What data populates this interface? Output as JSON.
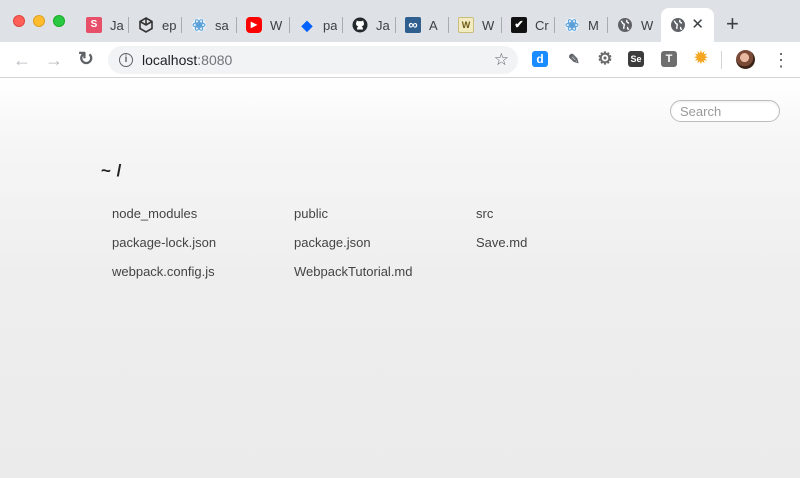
{
  "window": {
    "controls": [
      "close",
      "minimize",
      "zoom"
    ]
  },
  "tabs": [
    {
      "title": "Ja",
      "icon": "s-letter-icon",
      "color": "#e8506a",
      "glyph": "S"
    },
    {
      "title": "ep",
      "icon": "cube-icon",
      "color": "#333333",
      "glyph": ""
    },
    {
      "title": "sa",
      "icon": "react-icon",
      "color": "#5aa0d8",
      "glyph": ""
    },
    {
      "title": "W",
      "icon": "youtube-icon",
      "color": "#ff0000",
      "glyph": "▶"
    },
    {
      "title": "pa",
      "icon": "dropbox-icon",
      "color": "#0061fe",
      "glyph": "◆"
    },
    {
      "title": "Ja",
      "icon": "github-icon",
      "color": "#24292e",
      "glyph": ""
    },
    {
      "title": "A",
      "icon": "infinity-icon",
      "color": "#2f5f8f",
      "glyph": "∞"
    },
    {
      "title": "W",
      "icon": "w-letter-icon",
      "color": "#f3ecc2",
      "glyph": "W"
    },
    {
      "title": "Cr",
      "icon": "checkbox-icon",
      "color": "#111111",
      "glyph": "✔"
    },
    {
      "title": "M",
      "icon": "react-icon",
      "color": "#5aa0d8",
      "glyph": ""
    },
    {
      "title": "W",
      "icon": "globe-icon",
      "color": "#5f6368",
      "glyph": ""
    },
    {
      "title": "",
      "icon": "globe-icon",
      "color": "#5f6368",
      "glyph": "",
      "active": true
    }
  ],
  "active_tab_close": "✕",
  "new_tab": "+",
  "nav": {
    "back": "←",
    "forward": "→",
    "reload": "↻"
  },
  "address": {
    "host": "localhost",
    "port": ":8080",
    "info": "i",
    "star": "☆"
  },
  "extensions": [
    {
      "name": "d-extension-icon",
      "color": "#1a8cff",
      "glyph": "d"
    },
    {
      "name": "eyedropper-icon",
      "color": "#5f6368",
      "glyph": "✎"
    },
    {
      "name": "gear-extension-icon",
      "color": "#6b6b6b",
      "glyph": "⚙"
    },
    {
      "name": "selenium-icon",
      "color": "#3c3c3c",
      "glyph": "Se"
    },
    {
      "name": "t-extension-icon",
      "color": "#6e6e6e",
      "glyph": "T"
    },
    {
      "name": "sun-extension-icon",
      "color": "#f5a623",
      "glyph": "✹"
    }
  ],
  "menu": "⋮",
  "page": {
    "search_placeholder": "Search",
    "path": "~ /",
    "files": [
      "node_modules",
      "public",
      "src",
      "package-lock.json",
      "package.json",
      "Save.md",
      "webpack.config.js",
      "WebpackTutorial.md"
    ]
  }
}
